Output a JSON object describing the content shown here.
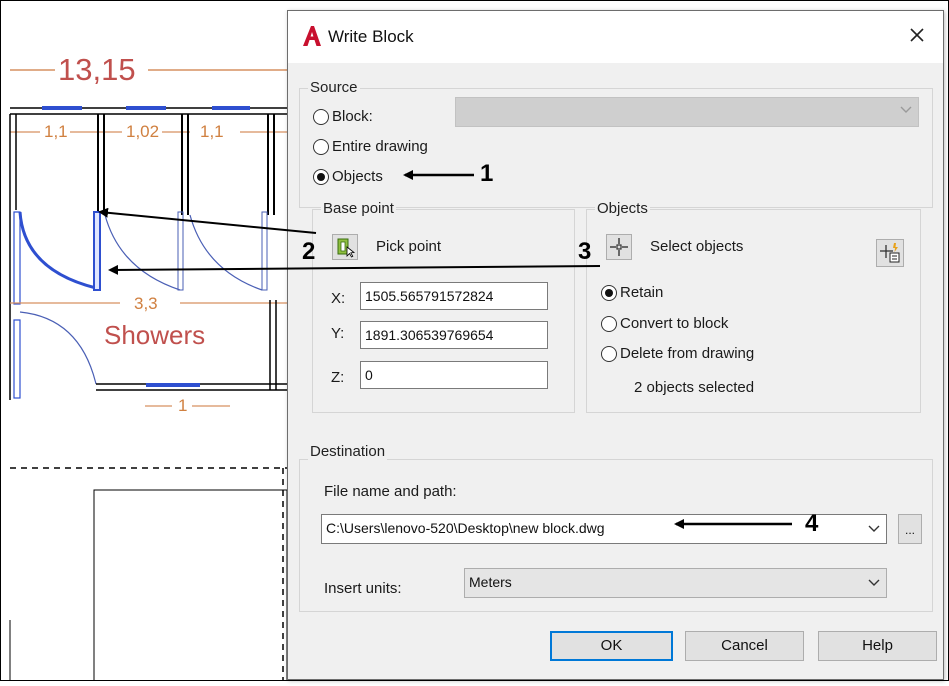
{
  "drawing": {
    "dim_top": "13,15",
    "dim_a": "1,1",
    "dim_b": "1,02",
    "dim_c": "1,1",
    "dim_width": "3,3",
    "dim_door": "1",
    "room_label": "Showers"
  },
  "dialog": {
    "title": "Write Block",
    "source": {
      "label": "Source",
      "options": [
        "Block:",
        "Entire drawing",
        "Objects"
      ],
      "selected": "Objects"
    },
    "base_point": {
      "label": "Base point",
      "pick_label": "Pick point",
      "x_label": "X:",
      "x_value": "1505.565791572824",
      "y_label": "Y:",
      "y_value": "1891.306539769654",
      "z_label": "Z:",
      "z_value": "0"
    },
    "objects": {
      "label": "Objects",
      "select_label": "Select objects",
      "options": [
        "Retain",
        "Convert to block",
        "Delete from drawing"
      ],
      "selected": "Retain",
      "status": "2 objects selected"
    },
    "destination": {
      "label": "Destination",
      "file_label": "File name and path:",
      "file_value": "C:\\Users\\lenovo-520\\Desktop\\new block.dwg",
      "browse_label": "...",
      "units_label": "Insert units:",
      "units_value": "Meters"
    },
    "buttons": {
      "ok": "OK",
      "cancel": "Cancel",
      "help": "Help"
    }
  },
  "annotations": {
    "n1": "1",
    "n2": "2",
    "n3": "3",
    "n4": "4"
  },
  "colors": {
    "dimension": "#c0504d",
    "window_blue": "#2e4fd0",
    "accent": "#0078d7",
    "autocad_red": "#c8102e"
  },
  "icons": [
    "autocad-logo-icon",
    "close-icon",
    "pick-point-icon",
    "select-objects-icon",
    "quick-select-icon",
    "chevron-down-icon"
  ]
}
